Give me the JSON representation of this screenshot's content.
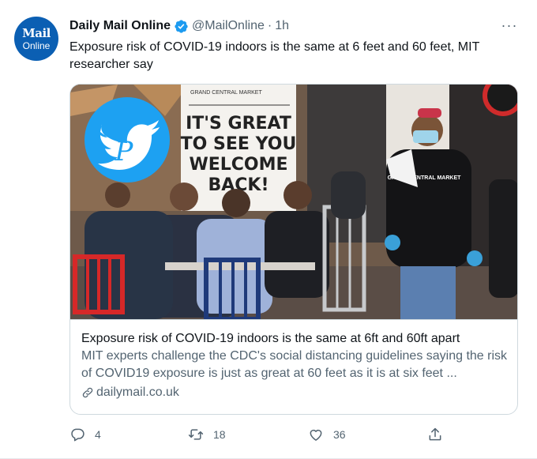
{
  "account": {
    "name": "Daily Mail Online",
    "handle": "@MailOnline",
    "separator": "·",
    "time": "1h",
    "avatar_line1": "Mail",
    "avatar_line2": "Online",
    "verified": true
  },
  "more_label": "···",
  "tweet": {
    "text": "Exposure risk of COVID-19 indoors is the same at 6 feet and 60 feet, MIT researcher say"
  },
  "card": {
    "sign_top": "GRAND CENTRAL MARKET",
    "sign_lines": [
      "IT'S GREAT",
      "TO SEE YOU",
      "WELCOME",
      "BACK!"
    ],
    "apron_text": "GRAND CENTRAL MARKET",
    "title": "Exposure risk of COVID-19 indoors is the same at 6ft and 60ft apart",
    "description": "MIT experts challenge the CDC's social distancing guidelines saying the risk of COVID19 exposure is just as great at 60 feet as it is at six feet ...",
    "domain": "dailymail.co.uk"
  },
  "actions": {
    "replies": "4",
    "retweets": "18",
    "likes": "36"
  },
  "colors": {
    "brand_avatar": "#0b5fb3",
    "verified_badge": "#1d9bf0",
    "secondary_text": "#536471",
    "card_border": "#cfd9de"
  },
  "icons": [
    "verified-badge-icon",
    "more-icon",
    "link-icon",
    "reply-icon",
    "retweet-icon",
    "like-icon",
    "share-icon"
  ]
}
